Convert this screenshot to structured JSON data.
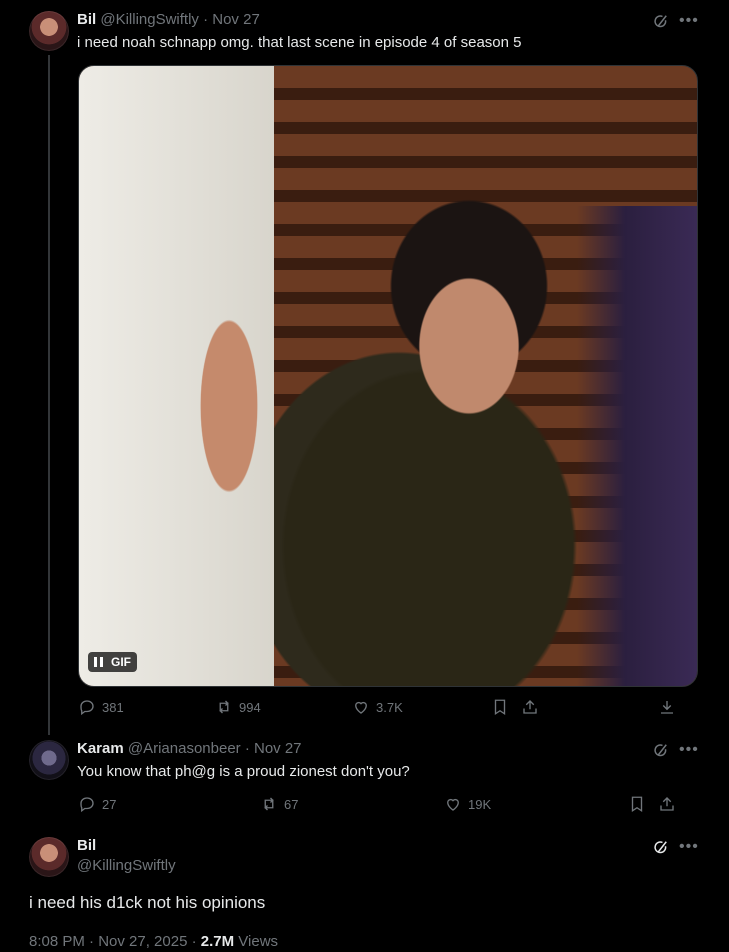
{
  "tweet1": {
    "name": "Bil",
    "meta": "@KillingSwiftly · Nov 27",
    "text": "i need noah schnapp omg. that last scene in episode 4 of season 5",
    "gif_label": "GIF",
    "actions": {
      "replies": "381",
      "reposts": "994",
      "likes": "3.7K"
    }
  },
  "tweet2": {
    "name": "Karam",
    "meta": "@Arianasonbeer · Nov 27",
    "text": "You know that ph@g is a proud zionest don't you?",
    "actions": {
      "replies": "27",
      "reposts": "67",
      "likes": "19K"
    }
  },
  "tweet3": {
    "name": "Bil",
    "handle": "@KillingSwiftly",
    "text": "i need his d1ck not his opinions",
    "footer_time": "8:08 PM · Nov 27, 2025 · ",
    "footer_views_count": "2.7M",
    "footer_views_label": " Views"
  },
  "icons": {
    "grok": "grok-icon",
    "more": "more-icon",
    "reply": "reply-icon",
    "repost": "repost-icon",
    "like": "like-icon",
    "bookmark": "bookmark-icon",
    "share": "share-icon",
    "download": "download-icon"
  },
  "colors": {
    "background": "#000000",
    "text": "#e7e9ea",
    "muted": "#71767b",
    "border": "#2f3336"
  }
}
